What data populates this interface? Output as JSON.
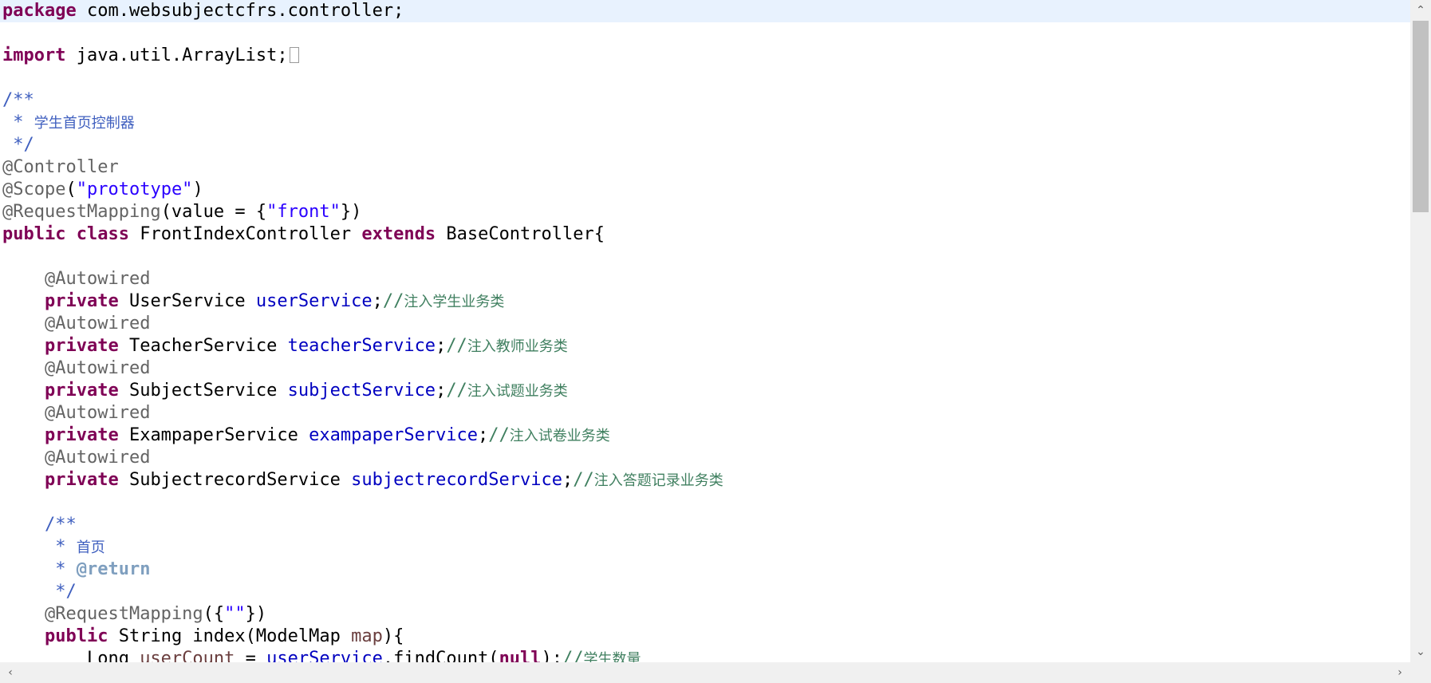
{
  "editor": {
    "lines": [
      {
        "current": true,
        "tokens": [
          {
            "t": "kw",
            "v": "package"
          },
          {
            "t": "plain",
            "v": " com.websubjectcfrs.controller;"
          }
        ]
      },
      {
        "tokens": []
      },
      {
        "tokens": [
          {
            "t": "kw",
            "v": "import"
          },
          {
            "t": "plain",
            "v": " java.util.ArrayList;"
          },
          {
            "t": "fold",
            "v": ""
          }
        ]
      },
      {
        "tokens": []
      },
      {
        "tokens": [
          {
            "t": "jdoc",
            "v": "/**"
          }
        ]
      },
      {
        "tokens": [
          {
            "t": "jdoc",
            "v": " * "
          },
          {
            "t": "jdoc-cjk",
            "v": "学生首页控制器"
          }
        ]
      },
      {
        "tokens": [
          {
            "t": "jdoc",
            "v": " */"
          }
        ]
      },
      {
        "tokens": [
          {
            "t": "ann",
            "v": "@Controller"
          }
        ]
      },
      {
        "tokens": [
          {
            "t": "ann",
            "v": "@Scope"
          },
          {
            "t": "plain",
            "v": "("
          },
          {
            "t": "str",
            "v": "\"prototype\""
          },
          {
            "t": "plain",
            "v": ")"
          }
        ]
      },
      {
        "tokens": [
          {
            "t": "ann",
            "v": "@RequestMapping"
          },
          {
            "t": "plain",
            "v": "(value = {"
          },
          {
            "t": "str",
            "v": "\"front\""
          },
          {
            "t": "plain",
            "v": "})"
          }
        ]
      },
      {
        "tokens": [
          {
            "t": "kw",
            "v": "public"
          },
          {
            "t": "plain",
            "v": " "
          },
          {
            "t": "kw",
            "v": "class"
          },
          {
            "t": "plain",
            "v": " FrontIndexController "
          },
          {
            "t": "kw",
            "v": "extends"
          },
          {
            "t": "plain",
            "v": " BaseController{"
          }
        ]
      },
      {
        "tokens": []
      },
      {
        "tokens": [
          {
            "t": "plain",
            "v": "    "
          },
          {
            "t": "ann",
            "v": "@Autowired"
          }
        ]
      },
      {
        "tokens": [
          {
            "t": "plain",
            "v": "    "
          },
          {
            "t": "kw",
            "v": "private"
          },
          {
            "t": "plain",
            "v": " UserService "
          },
          {
            "t": "field",
            "v": "userService"
          },
          {
            "t": "plain",
            "v": ";"
          },
          {
            "t": "cmt",
            "v": "//"
          },
          {
            "t": "cmt-cjk",
            "v": "注入学生业务类"
          }
        ]
      },
      {
        "tokens": [
          {
            "t": "plain",
            "v": "    "
          },
          {
            "t": "ann",
            "v": "@Autowired"
          }
        ]
      },
      {
        "tokens": [
          {
            "t": "plain",
            "v": "    "
          },
          {
            "t": "kw",
            "v": "private"
          },
          {
            "t": "plain",
            "v": " TeacherService "
          },
          {
            "t": "field",
            "v": "teacherService"
          },
          {
            "t": "plain",
            "v": ";"
          },
          {
            "t": "cmt",
            "v": "//"
          },
          {
            "t": "cmt-cjk",
            "v": "注入教师业务类"
          }
        ]
      },
      {
        "tokens": [
          {
            "t": "plain",
            "v": "    "
          },
          {
            "t": "ann",
            "v": "@Autowired"
          }
        ]
      },
      {
        "tokens": [
          {
            "t": "plain",
            "v": "    "
          },
          {
            "t": "kw",
            "v": "private"
          },
          {
            "t": "plain",
            "v": " SubjectService "
          },
          {
            "t": "field",
            "v": "subjectService"
          },
          {
            "t": "plain",
            "v": ";"
          },
          {
            "t": "cmt",
            "v": "//"
          },
          {
            "t": "cmt-cjk",
            "v": "注入试题业务类"
          }
        ]
      },
      {
        "tokens": [
          {
            "t": "plain",
            "v": "    "
          },
          {
            "t": "ann",
            "v": "@Autowired"
          }
        ]
      },
      {
        "tokens": [
          {
            "t": "plain",
            "v": "    "
          },
          {
            "t": "kw",
            "v": "private"
          },
          {
            "t": "plain",
            "v": " ExampaperService "
          },
          {
            "t": "field",
            "v": "exampaperService"
          },
          {
            "t": "plain",
            "v": ";"
          },
          {
            "t": "cmt",
            "v": "//"
          },
          {
            "t": "cmt-cjk",
            "v": "注入试卷业务类"
          }
        ]
      },
      {
        "tokens": [
          {
            "t": "plain",
            "v": "    "
          },
          {
            "t": "ann",
            "v": "@Autowired"
          }
        ]
      },
      {
        "tokens": [
          {
            "t": "plain",
            "v": "    "
          },
          {
            "t": "kw",
            "v": "private"
          },
          {
            "t": "plain",
            "v": " SubjectrecordService "
          },
          {
            "t": "field",
            "v": "subjectrecordService"
          },
          {
            "t": "plain",
            "v": ";"
          },
          {
            "t": "cmt",
            "v": "//"
          },
          {
            "t": "cmt-cjk",
            "v": "注入答题记录业务类"
          }
        ]
      },
      {
        "tokens": []
      },
      {
        "tokens": [
          {
            "t": "plain",
            "v": "    "
          },
          {
            "t": "jdoc",
            "v": "/**"
          }
        ]
      },
      {
        "tokens": [
          {
            "t": "plain",
            "v": "    "
          },
          {
            "t": "jdoc",
            "v": " * "
          },
          {
            "t": "jdoc-cjk",
            "v": "首页"
          }
        ]
      },
      {
        "tokens": [
          {
            "t": "plain",
            "v": "    "
          },
          {
            "t": "jdoc",
            "v": " * "
          },
          {
            "t": "jdoc-tag",
            "v": "@return"
          }
        ]
      },
      {
        "tokens": [
          {
            "t": "plain",
            "v": "    "
          },
          {
            "t": "jdoc",
            "v": " */"
          }
        ]
      },
      {
        "tokens": [
          {
            "t": "plain",
            "v": "    "
          },
          {
            "t": "ann",
            "v": "@RequestMapping"
          },
          {
            "t": "plain",
            "v": "({"
          },
          {
            "t": "str",
            "v": "\"\""
          },
          {
            "t": "plain",
            "v": "})"
          }
        ]
      },
      {
        "tokens": [
          {
            "t": "plain",
            "v": "    "
          },
          {
            "t": "kw",
            "v": "public"
          },
          {
            "t": "plain",
            "v": " String index(ModelMap "
          },
          {
            "t": "local",
            "v": "map"
          },
          {
            "t": "plain",
            "v": "){"
          }
        ]
      },
      {
        "tokens": [
          {
            "t": "plain",
            "v": "        Long "
          },
          {
            "t": "local",
            "v": "userCount"
          },
          {
            "t": "plain",
            "v": " = "
          },
          {
            "t": "field",
            "v": "userService"
          },
          {
            "t": "plain",
            "v": ".findCount("
          },
          {
            "t": "kw",
            "v": "null"
          },
          {
            "t": "plain",
            "v": ");"
          },
          {
            "t": "cmt",
            "v": "//"
          },
          {
            "t": "cmt-cjk",
            "v": "学生数量"
          }
        ]
      }
    ]
  },
  "scrollbars": {
    "up_glyph": "⌃",
    "down_glyph": "⌄",
    "left_glyph": "‹",
    "right_glyph": "›"
  }
}
